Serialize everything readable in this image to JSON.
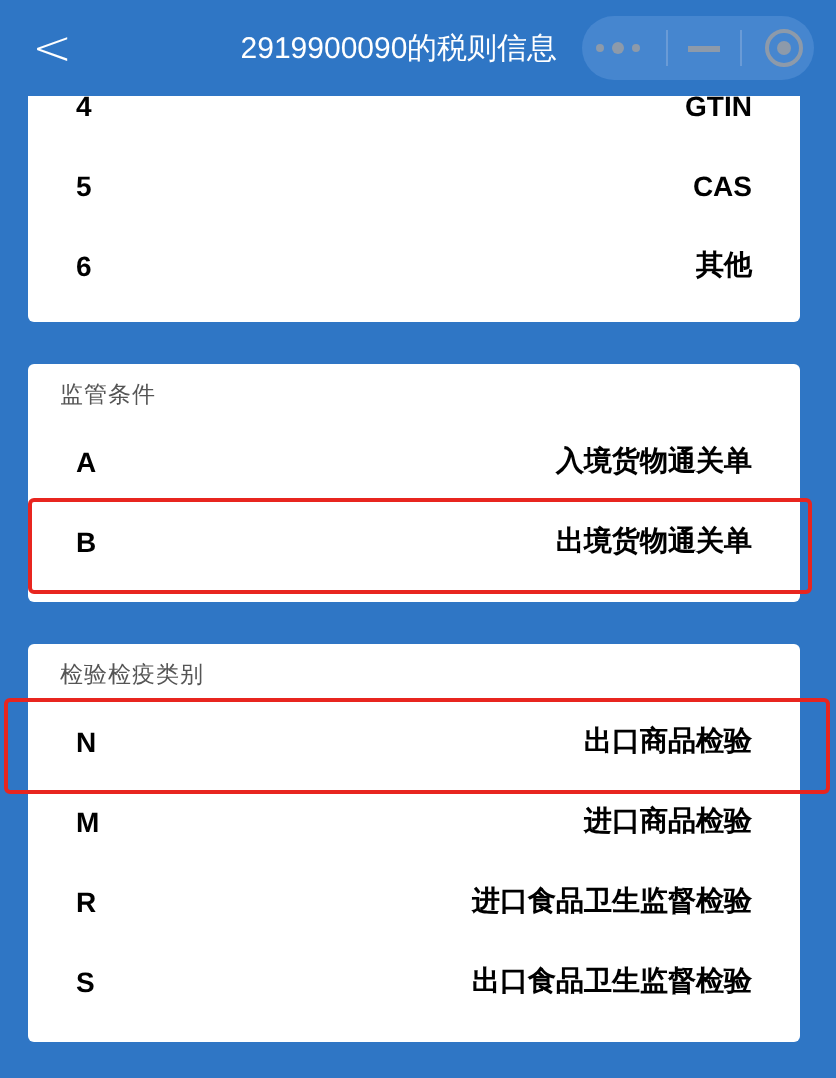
{
  "header": {
    "back": "<",
    "title": "2919900090的税则信息"
  },
  "sections": [
    {
      "rows": [
        {
          "code": "4",
          "name": "GTIN",
          "highlighted": false
        },
        {
          "code": "5",
          "name": "CAS",
          "highlighted": false
        },
        {
          "code": "6",
          "name": "其他",
          "highlighted": false
        }
      ]
    },
    {
      "title": "监管条件",
      "rows": [
        {
          "code": "A",
          "name": "入境货物通关单",
          "highlighted": false
        },
        {
          "code": "B",
          "name": "出境货物通关单",
          "highlighted": true
        }
      ]
    },
    {
      "title": "检验检疫类别",
      "rows": [
        {
          "code": "N",
          "name": "出口商品检验",
          "highlighted": true
        },
        {
          "code": "M",
          "name": "进口商品检验",
          "highlighted": false
        },
        {
          "code": "R",
          "name": "进口食品卫生监督检验",
          "highlighted": false
        },
        {
          "code": "S",
          "name": "出口食品卫生监督检验",
          "highlighted": false
        }
      ]
    }
  ]
}
